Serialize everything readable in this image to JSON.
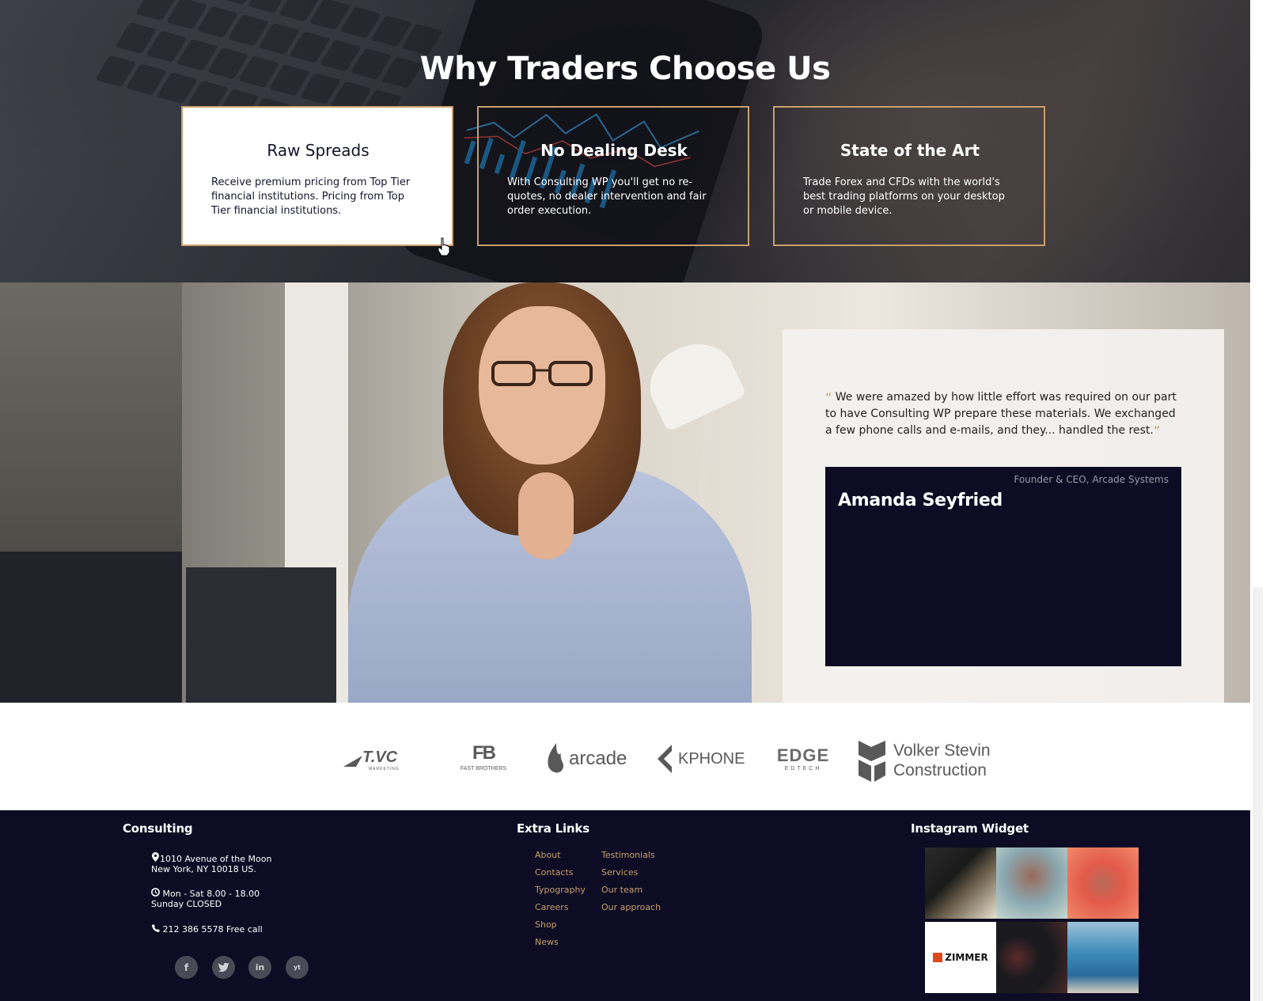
{
  "features_section": {
    "title": "Why Traders Choose Us",
    "cards": [
      {
        "title": "Raw Spreads",
        "text": "Receive premium pricing from Top Tier financial institutions. Pricing from Top Tier financial institutions."
      },
      {
        "title": "No Dealing Desk",
        "text": "With Consulting WP you'll get no re-quotes, no dealer intervention and fair order execution."
      },
      {
        "title": "State of the Art",
        "text": "Trade Forex and CFDs with the world's best trading platforms on your desktop or mobile device."
      }
    ]
  },
  "testimonial": {
    "open_quote": "“",
    "close_quote": "”",
    "text": "We were amazed by how little effort was required on our part to have Consulting WP prepare these materials. We exchanged a few phone calls and e-mails, and they... handled the rest.",
    "author_role": "Founder & CEO, Arcade Systems",
    "author_name": "Amanda Seyfried"
  },
  "client_logos": [
    {
      "name": "T.VC",
      "sub": "MARKETING"
    },
    {
      "name": "FB",
      "sub": "FAST BROTHERS"
    },
    {
      "name": "arcade",
      "sub": ""
    },
    {
      "name": "KPHONE",
      "sub": ""
    },
    {
      "name": "EDGE",
      "sub": "EDTECH"
    },
    {
      "name": "Volker Stevin",
      "sub": "Construction"
    }
  ],
  "footer": {
    "consulting": {
      "heading": "Consulting",
      "address_line1": "1010 Avenue of the Moon",
      "address_line2": "New York, NY 10018 US.",
      "hours_line1": "Mon - Sat 8.00 - 18.00",
      "hours_line2": "Sunday CLOSED",
      "phone": "212 386 5578 Free call",
      "social": [
        "f",
        "t",
        "in",
        "yt"
      ]
    },
    "extra_links": {
      "heading": "Extra Links",
      "col1": [
        "About",
        "Contacts",
        "Typography",
        "Careers",
        "Shop",
        "News"
      ],
      "col2": [
        "Testimonials",
        "Services",
        "Our team",
        "Our approach"
      ]
    },
    "instagram": {
      "heading": "Instagram Widget",
      "tile_label": "ZIMMER"
    }
  },
  "colors": {
    "accent_gold": "#c8a06a",
    "navy": "#0d0c24"
  }
}
